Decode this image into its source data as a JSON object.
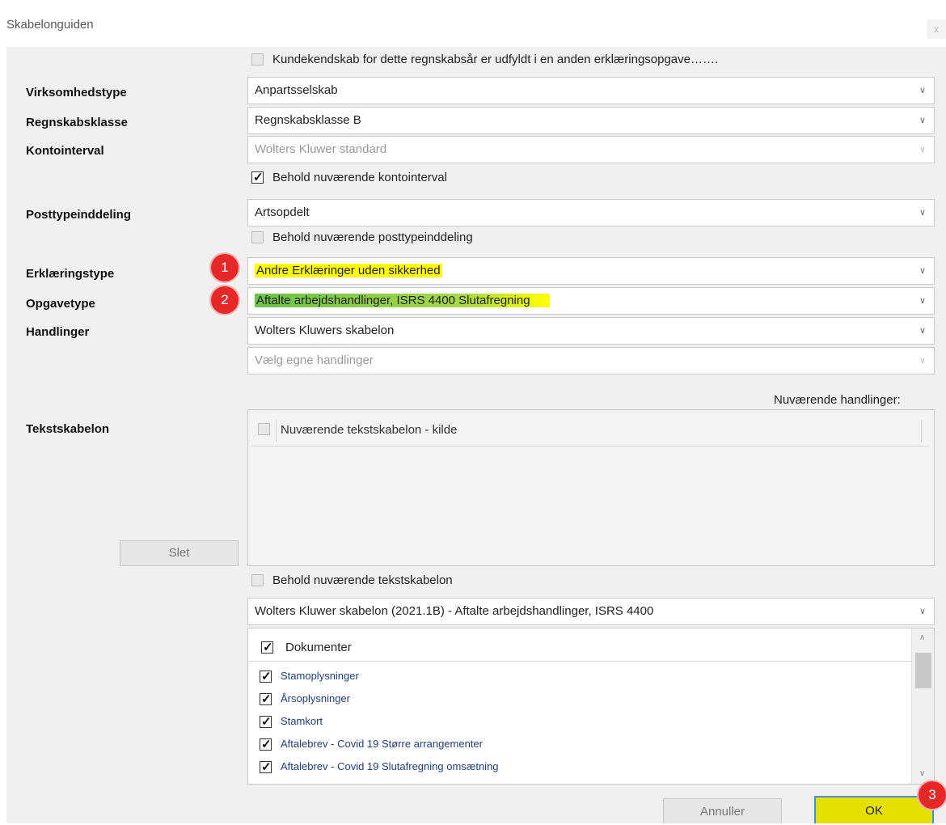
{
  "window": {
    "title": "Skabelonguiden",
    "close_label": "x"
  },
  "top_checkbox": {
    "label": "Kundekendskab for dette regnskabsår er udfyldt i en anden erklæringsopgave……."
  },
  "fields": {
    "virksomhedstype": {
      "label": "Virksomhedstype",
      "value": "Anpartsselskab"
    },
    "regnskabsklasse": {
      "label": "Regnskabsklasse",
      "value": "Regnskabsklasse B"
    },
    "kontointerval": {
      "label": "Kontointerval",
      "value": "Wolters Kluwer standard"
    },
    "behold_kontointerval": {
      "label": "Behold nuværende kontointerval"
    },
    "posttypeinddeling": {
      "label": "Posttypeinddeling",
      "value": "Artsopdelt"
    },
    "behold_posttypeinddeling": {
      "label": "Behold nuværende posttypeinddeling"
    },
    "erklaeringstype": {
      "label": "Erklæringstype",
      "value": "Andre Erklæringer uden sikkerhed"
    },
    "opgavetype": {
      "label": "Opgavetype",
      "value": "Aftalte arbejdshandlinger, ISRS 4400 Slutafregning"
    },
    "handlinger": {
      "label": "Handlinger",
      "value": "Wolters Kluwers skabelon",
      "secondary": "Vælg egne handlinger"
    }
  },
  "current_actions_label": "Nuværende handlinger:",
  "tekstskabelon": {
    "label": "Tekstskabelon",
    "column_header": "Nuværende tekstskabelon - kilde",
    "delete_button": "Slet",
    "behold_label": "Behold nuværende tekstskabelon",
    "template_value": "Wolters Kluwer skabelon (2021.1B) - Aftalte arbejdshandlinger, ISRS 4400"
  },
  "documents": {
    "header": "Dokumenter",
    "items": [
      "Stamoplysninger",
      "Årsoplysninger",
      "Stamkort",
      "Aftalebrev - Covid 19 Større arrangementer",
      "Aftalebrev - Covid 19 Slutafregning omsætning"
    ]
  },
  "buttons": {
    "cancel": "Annuller",
    "ok": "OK"
  },
  "annotations": {
    "badge1": "1",
    "badge2": "2",
    "badge3": "3"
  },
  "colors": {
    "highlight_yellow": "#ffff00",
    "highlight_green": "#6cc24a",
    "badge_red": "#e62828",
    "link_blue": "#1f3f7a"
  },
  "icons": {
    "dropdown": "chevron-down-icon",
    "scroll_up": "chevron-up-icon",
    "scroll_down": "chevron-down-icon",
    "check": "checkmark-icon"
  }
}
